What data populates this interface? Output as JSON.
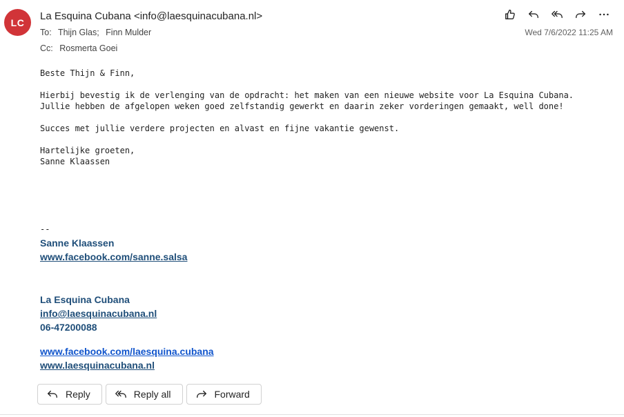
{
  "header": {
    "avatar_initials": "LC",
    "avatar_color": "#d13438",
    "sender": "La Esquina Cubana <info@laesquinacubana.nl>",
    "to_label": "To:",
    "to": [
      "Thijn Glas;",
      "Finn Mulder"
    ],
    "cc_label": "Cc:",
    "cc": [
      "Rosmerta Goei"
    ],
    "date": "Wed 7/6/2022 11:25 AM",
    "toolbar_icons": [
      "like-icon",
      "reply-icon",
      "reply-all-icon",
      "forward-icon",
      "more-icon"
    ]
  },
  "body": {
    "greeting": "Beste Thijn & Finn,",
    "paragraph1_line1": "Hierbij bevestig ik de verlenging van de opdracht: het maken van een nieuwe website voor La Esquina Cubana.",
    "paragraph1_line2": "Jullie hebben de afgelopen weken goed zelfstandig gewerkt en daarin zeker vorderingen gemaakt, well done!",
    "paragraph2": "Succes met jullie verdere projecten en alvast en fijne vakantie gewenst.",
    "closing": "Hartelijke groeten,",
    "closing_name": "Sanne Klaassen"
  },
  "signature": {
    "dashes": "--",
    "person_name": "Sanne Klaassen",
    "person_facebook": "www.facebook.com/sanne.salsa",
    "company_name": "La Esquina Cubana",
    "company_email": "info@laesquinacubana.nl",
    "company_phone": "06-47200088",
    "company_facebook": "www.facebook.com/laesquina.cubana",
    "company_website": "www.laesquinacubana.nl",
    "link_color": "#1f4e79"
  },
  "actions": {
    "reply": "Reply",
    "reply_all": "Reply all",
    "forward": "Forward"
  }
}
